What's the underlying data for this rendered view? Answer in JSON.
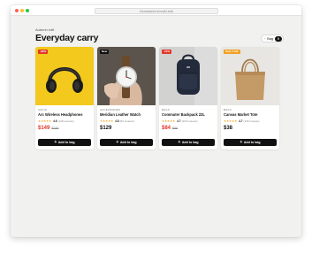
{
  "browser": {
    "url": "Canvasrer-vccsAi.sim"
  },
  "header": {
    "eyebrow": "Autumn edit",
    "title": "Everyday carry"
  },
  "bag": {
    "label": "Bag",
    "count": "0"
  },
  "products": [
    {
      "badge": "-18%",
      "badge_color": "#e2372a",
      "category": "AUDIO",
      "name": "Arc Wireless Headphones",
      "stars": "★★★★★",
      "score": "4.6",
      "reviews": "(128 reviews)",
      "price": "$149",
      "was": "$189",
      "on_sale": true,
      "add_label": "Add to bag"
    },
    {
      "badge": "New",
      "badge_color": "#111111",
      "category": "ACCESSORIES",
      "name": "Meridian Leather Watch",
      "stars": "★★★★★",
      "score": "4.8",
      "reviews": "(84 reviews)",
      "price": "$129",
      "was": "",
      "on_sale": false,
      "add_label": "Add to bag"
    },
    {
      "badge": "-15%",
      "badge_color": "#e2372a",
      "category": "BAGS",
      "name": "Commuter Backpack 22L",
      "stars": "★★★★★",
      "score": "4.7",
      "reviews": "(203 reviews)",
      "price": "$84",
      "was": "$99",
      "on_sale": true,
      "add_label": "Add to bag"
    },
    {
      "badge": "Only 3 left",
      "badge_color": "#f0a020",
      "category": "BAGS",
      "name": "Canvas Market Tote",
      "stars": "★★★★★",
      "score": "4.7",
      "reviews": "(160 reviews)",
      "price": "$38",
      "was": "",
      "on_sale": false,
      "add_label": "Add to bag"
    }
  ]
}
